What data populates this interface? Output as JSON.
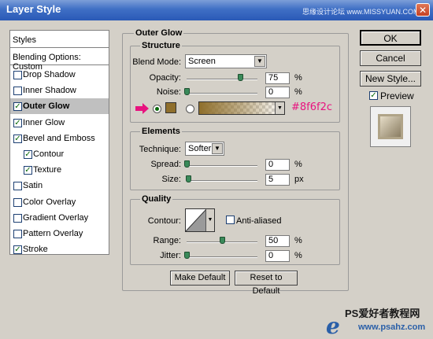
{
  "window": {
    "title": "Layer Style",
    "watermark": "思缘设计论坛 www.MISSYUAN.COM"
  },
  "sidebar": {
    "header": "Styles",
    "blending": "Blending Options: Custom",
    "items": [
      {
        "label": "Drop Shadow",
        "checked": false
      },
      {
        "label": "Inner Shadow",
        "checked": false
      },
      {
        "label": "Outer Glow",
        "checked": true,
        "selected": true
      },
      {
        "label": "Inner Glow",
        "checked": true
      },
      {
        "label": "Bevel and Emboss",
        "checked": true
      },
      {
        "label": "Contour",
        "checked": true,
        "sub": true
      },
      {
        "label": "Texture",
        "checked": true,
        "sub": true
      },
      {
        "label": "Satin",
        "checked": false
      },
      {
        "label": "Color Overlay",
        "checked": false
      },
      {
        "label": "Gradient Overlay",
        "checked": false
      },
      {
        "label": "Pattern Overlay",
        "checked": false
      },
      {
        "label": "Stroke",
        "checked": true
      }
    ]
  },
  "outer_glow": {
    "title": "Outer Glow",
    "structure": {
      "title": "Structure",
      "blend_mode_label": "Blend Mode:",
      "blend_mode": "Screen",
      "opacity_label": "Opacity:",
      "opacity": "75",
      "opacity_unit": "%",
      "opacity_level": 0.75,
      "noise_label": "Noise:",
      "noise": "0",
      "noise_unit": "%",
      "noise_level": 0,
      "color_hex": "#8f6f2c",
      "arrow_color": "#e8137f"
    },
    "elements": {
      "title": "Elements",
      "technique_label": "Technique:",
      "technique": "Softer",
      "spread_label": "Spread:",
      "spread": "0",
      "spread_unit": "%",
      "spread_level": 0,
      "size_label": "Size:",
      "size": "5",
      "size_unit": "px",
      "size_level": 0.02
    },
    "quality": {
      "title": "Quality",
      "contour_label": "Contour:",
      "anti_aliased_label": "Anti-aliased",
      "anti_aliased": false,
      "range_label": "Range:",
      "range": "50",
      "range_unit": "%",
      "range_level": 0.5,
      "jitter_label": "Jitter:",
      "jitter": "0",
      "jitter_unit": "%",
      "jitter_level": 0
    },
    "make_default": "Make Default",
    "reset_default": "Reset to Default"
  },
  "actions": {
    "ok": "OK",
    "cancel": "Cancel",
    "new_style": "New Style...",
    "preview_label": "Preview",
    "preview_checked": true
  },
  "footer_watermark": {
    "line1": "PS爱好者教程网",
    "line2": "www.psahz.com",
    "logo": "e"
  }
}
